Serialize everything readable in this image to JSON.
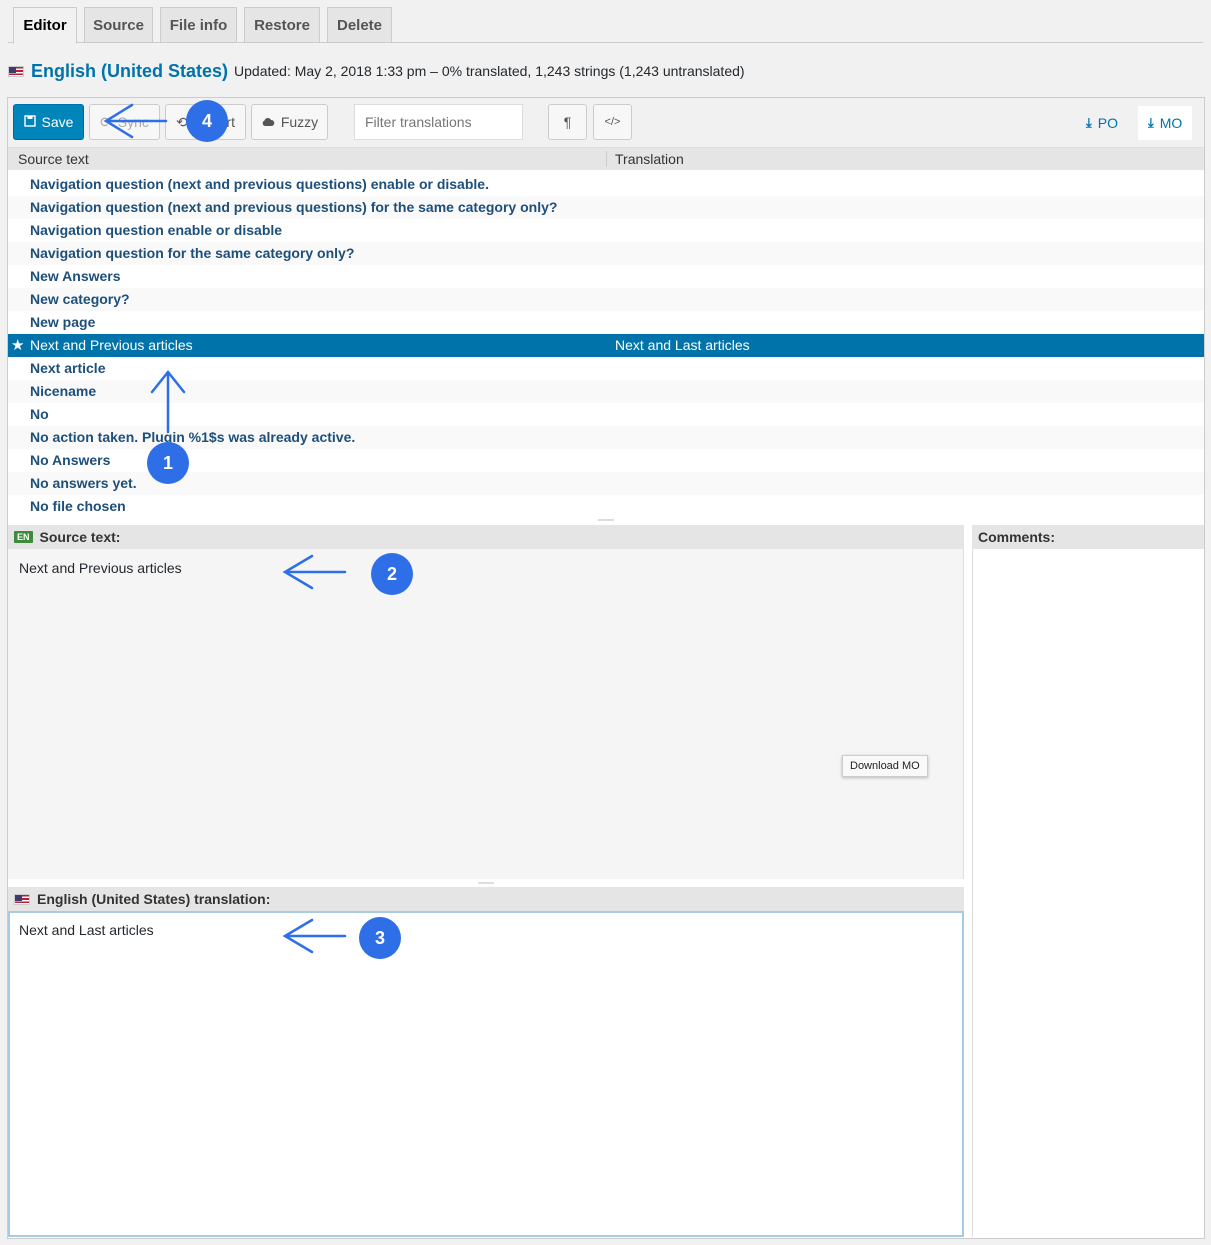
{
  "tabs": [
    "Editor",
    "Source",
    "File info",
    "Restore",
    "Delete"
  ],
  "header": {
    "language": "English (United States)",
    "status": "Updated: May 2, 2018 1:33 pm – 0% translated, 1,243 strings (1,243 untranslated)"
  },
  "toolbar": {
    "save": "Save",
    "sync": "Sync",
    "revert": "Revert",
    "fuzzy": "Fuzzy",
    "filter_placeholder": "Filter translations",
    "pilcrow": "¶",
    "code": "</>",
    "po": "PO",
    "mo": "MO"
  },
  "list": {
    "source_header": "Source text",
    "translation_header": "Translation",
    "rows": [
      {
        "source": "Navigation question (next and previous questions) enable or disable.",
        "translation": ""
      },
      {
        "source": "Navigation question (next and previous questions) for the same category only?",
        "translation": ""
      },
      {
        "source": "Navigation question enable or disable",
        "translation": ""
      },
      {
        "source": "Navigation question for the same category only?",
        "translation": ""
      },
      {
        "source": "New Answers",
        "translation": ""
      },
      {
        "source": "New category?",
        "translation": ""
      },
      {
        "source": "New page",
        "translation": ""
      },
      {
        "source": "Next and Previous articles",
        "translation": "Next and Last articles"
      },
      {
        "source": "Next article",
        "translation": ""
      },
      {
        "source": "Nicename",
        "translation": ""
      },
      {
        "source": "No",
        "translation": ""
      },
      {
        "source": "No action taken. Plugin %1$s was already active.",
        "translation": ""
      },
      {
        "source": "No Answers",
        "translation": ""
      },
      {
        "source": "No answers yet.",
        "translation": ""
      },
      {
        "source": "No file chosen",
        "translation": ""
      }
    ]
  },
  "source_pane": {
    "badge": "EN",
    "title": "Source text:",
    "text": "Next and Previous articles"
  },
  "target_pane": {
    "title": "English (United States) translation:",
    "text": "Next and Last articles"
  },
  "comments_pane": {
    "title": "Comments:"
  },
  "tooltip": "Download MO",
  "annotations": [
    "1",
    "2",
    "3",
    "4"
  ],
  "colors": {
    "accent": "#0073aa",
    "primary_button": "#0085ba",
    "annotation": "#2e6fe8",
    "selected_row": "#0073aa"
  }
}
